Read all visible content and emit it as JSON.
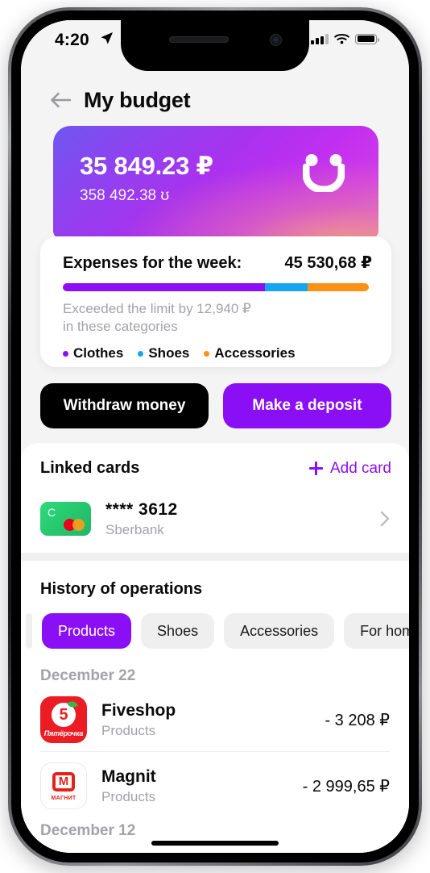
{
  "status_bar": {
    "time": "4:20",
    "location_icon": "location-arrow-icon",
    "signal_icon": "cellular-bars-icon",
    "wifi_icon": "wifi-icon",
    "battery_icon": "battery-full-icon"
  },
  "nav": {
    "back_icon": "back-arrow-icon",
    "title": "My budget"
  },
  "balance": {
    "amount": "35 849.23 ₽",
    "bonus": "358 492.38 ʊ",
    "logo_icon": "smiley-face-logo",
    "gradient_from": "#6f57f0",
    "gradient_to": "#f4a082"
  },
  "expenses": {
    "title": "Expenses for the week:",
    "total": "45 530,68 ₽",
    "note": "Exceeded the limit by 12,940 ₽\nin these categories",
    "note_line1": "Exceeded the limit by 12,940 ₽",
    "note_line2": "in these categories",
    "segments": [
      {
        "label": "Clothes",
        "color": "#8b0ff5",
        "percent": 66
      },
      {
        "label": "Shoes",
        "color": "#16a6f0",
        "percent": 14
      },
      {
        "label": "Accessories",
        "color": "#fb9215",
        "percent": 20
      }
    ]
  },
  "actions": {
    "withdraw_label": "Withdraw money",
    "deposit_label": "Make a deposit",
    "withdraw_color": "#000000",
    "deposit_color": "#8b0ff5"
  },
  "linked_cards": {
    "title": "Linked cards",
    "add_label": "Add card",
    "add_icon": "plus-icon",
    "accent_color": "#8b0ff5",
    "cards": [
      {
        "number": "**** 3612",
        "bank": "Sberbank",
        "card_letter": "С",
        "network_icon": "mastercard-icon",
        "chevron_icon": "chevron-right-icon"
      }
    ]
  },
  "history": {
    "title": "History of operations",
    "tabs": [
      {
        "label": "Products",
        "active": true
      },
      {
        "label": "Shoes",
        "active": false
      },
      {
        "label": "Accessories",
        "active": false
      },
      {
        "label": "For home",
        "active": false
      }
    ],
    "groups": [
      {
        "date": "December 22",
        "items": [
          {
            "merchant": "Fiveshop",
            "category": "Products",
            "amount": "- 3 208 ₽",
            "logo_icon": "fiveshop-logo",
            "logo_word": "Пятёрочка",
            "logo_digit": "5"
          },
          {
            "merchant": "Magnit",
            "category": "Products",
            "amount": "- 2 999,65 ₽",
            "logo_icon": "magnit-logo",
            "logo_word": "МАГНИТ",
            "logo_letter": "М"
          }
        ]
      },
      {
        "date": "December 12",
        "items": []
      }
    ]
  }
}
